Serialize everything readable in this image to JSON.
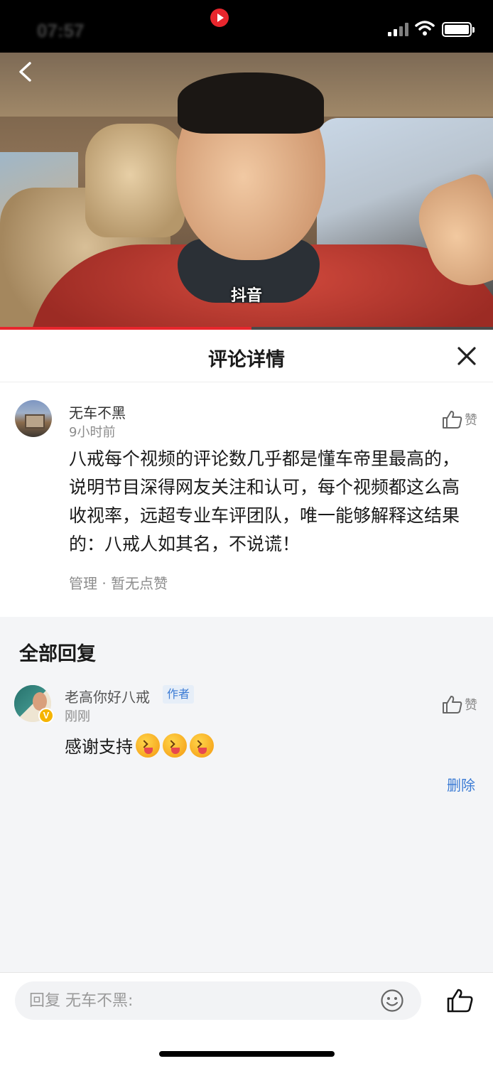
{
  "status_bar": {
    "time": "07:57"
  },
  "video": {
    "watermark": "抖音",
    "progress_pct": 51
  },
  "sheet": {
    "title": "评论详情"
  },
  "comment": {
    "user": "无车不黑",
    "time": "9小时前",
    "like_label": "赞",
    "body": "八戒每个视频的评论数几乎都是懂车帝里最高的，说明节目深得网友关注和认可，每个视频都这么高收视率，远超专业车评团队，唯一能够解释这结果的：八戒人如其名，不说谎！",
    "meta": "管理 · 暂无点赞"
  },
  "replies": {
    "title": "全部回复",
    "items": [
      {
        "user": "老高你好八戒",
        "tag": "作者",
        "time": "刚刚",
        "text": "感谢支持",
        "emoji_count": 3,
        "like_label": "赞",
        "delete_label": "删除",
        "badge": "V"
      }
    ]
  },
  "bottom_bar": {
    "placeholder": "回复 无车不黑:"
  },
  "colors": {
    "accent_red": "#e8262d",
    "link_blue": "#3b7bd4",
    "badge_gold": "#f5b400"
  },
  "icons": [
    "back-arrow-icon",
    "close-icon",
    "thumbs-up-icon",
    "emoji-icon",
    "verified-icon",
    "wifi-icon",
    "signal-icon",
    "battery-icon"
  ]
}
